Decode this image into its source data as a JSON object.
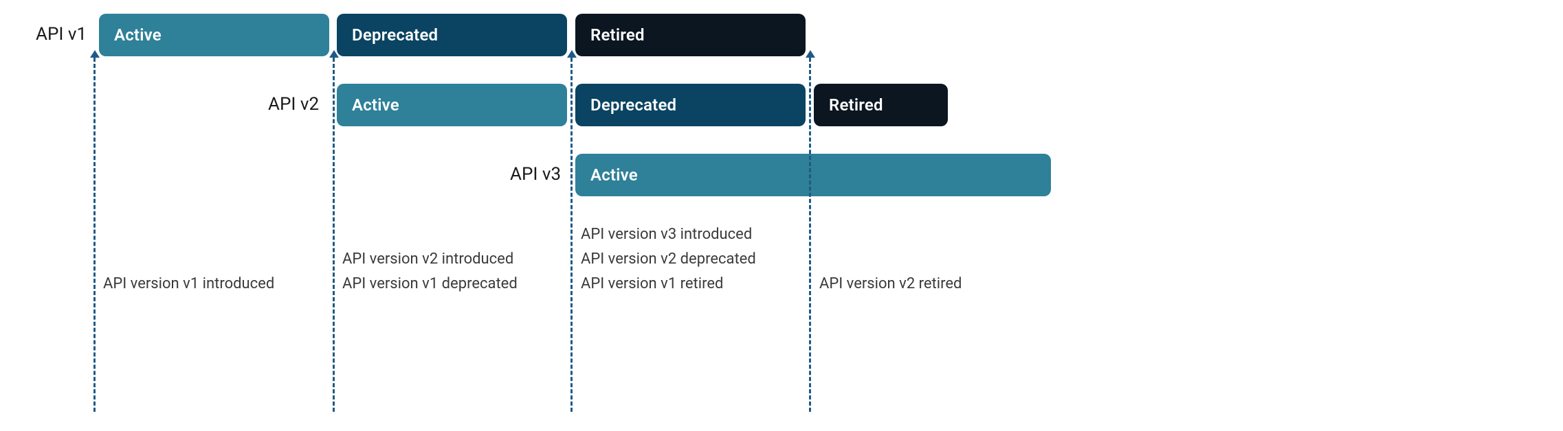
{
  "rows": {
    "v1": {
      "label": "API v1",
      "segments": {
        "active": "Active",
        "deprecated": "Deprecated",
        "retired": "Retired"
      }
    },
    "v2": {
      "label": "API v2",
      "segments": {
        "active": "Active",
        "deprecated": "Deprecated",
        "retired": "Retired"
      }
    },
    "v3": {
      "label": "API v3",
      "segments": {
        "active": "Active"
      }
    }
  },
  "events": {
    "e1": {
      "lines": [
        "API version v1 introduced"
      ]
    },
    "e2": {
      "lines": [
        "API version v2 introduced",
        "API version v1 deprecated"
      ]
    },
    "e3": {
      "lines": [
        "API version v3 introduced",
        "API version v2 deprecated",
        "API version v1 retired"
      ]
    },
    "e4": {
      "lines": [
        "API version v2 retired"
      ]
    }
  },
  "colors": {
    "active": "#2f8099",
    "deprecated": "#0a4462",
    "retired": "#0c1621",
    "arrow": "#1f5a87"
  }
}
